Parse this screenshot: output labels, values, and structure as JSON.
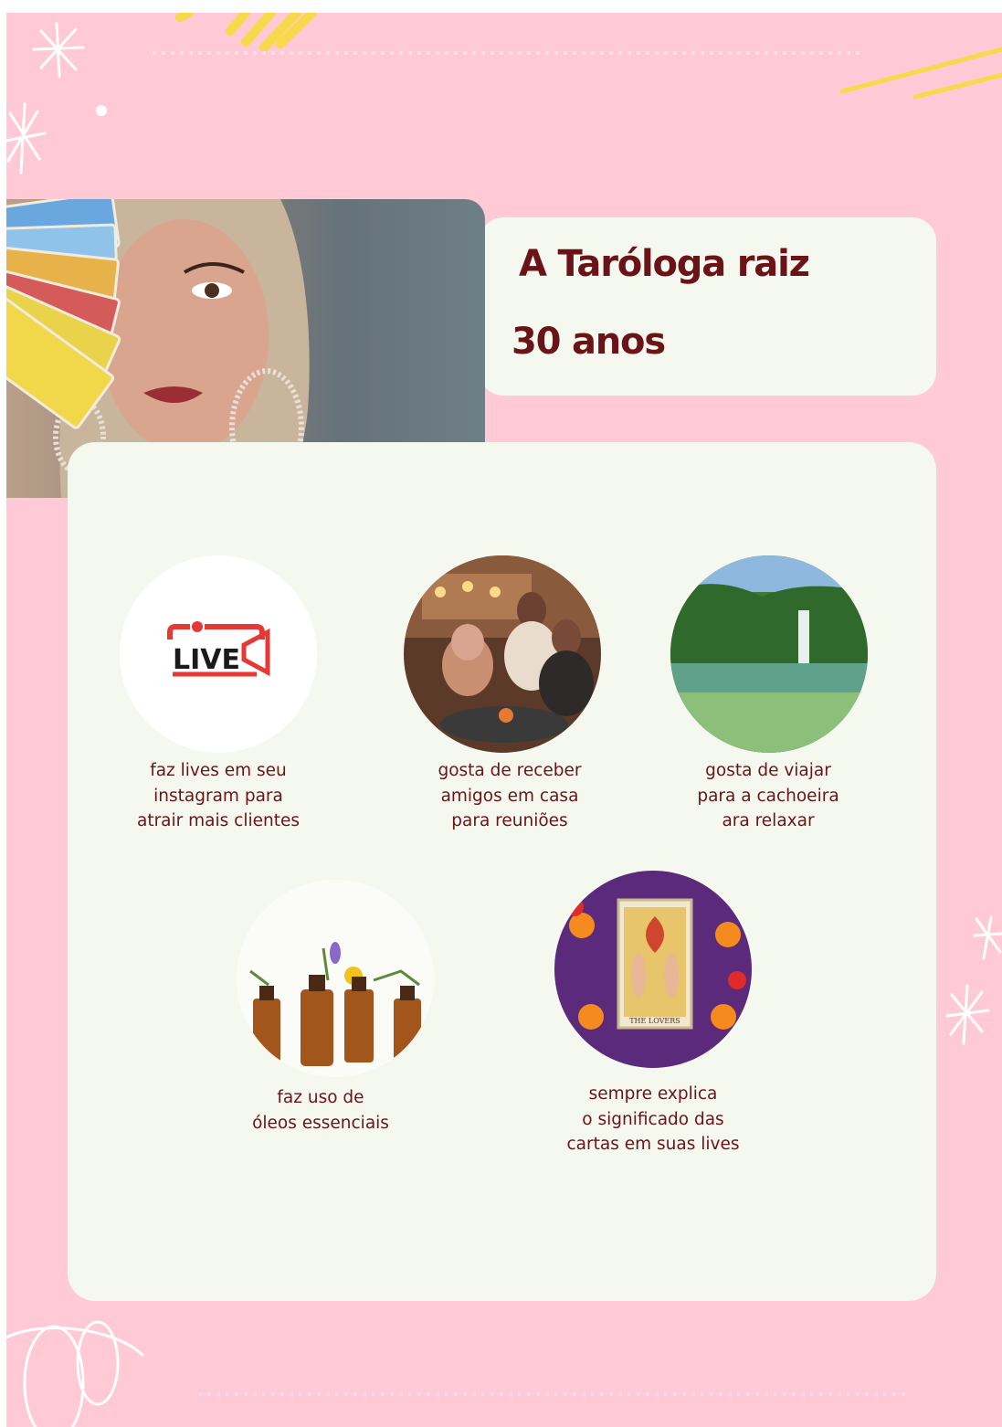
{
  "profile": {
    "title": "A Taróloga raiz",
    "age": "30 anos",
    "photo_alt": "Mulher segurando cartas de tarô em frente ao rosto"
  },
  "habits": [
    {
      "icon": "live-stream-icon",
      "live_label": "LIVE",
      "lines": [
        "faz lives em seu",
        "instagram para",
        "atrair mais clientes"
      ]
    },
    {
      "icon": "friends-gathering-photo",
      "lines": [
        "gosta de receber",
        "amigos em casa",
        "para reuniões"
      ]
    },
    {
      "icon": "waterfall-photo",
      "lines": [
        "gosta de viajar",
        "para a cachoeira",
        "ara relaxar"
      ]
    },
    {
      "icon": "essential-oils-photo",
      "lines": [
        "faz uso de",
        "óleos essenciais"
      ]
    },
    {
      "icon": "tarot-card-photo",
      "card_label": "THE LOVERS",
      "lines": [
        "sempre explica",
        "o significado das",
        "cartas em suas lives"
      ]
    }
  ],
  "colors": {
    "background": "#ffcad6",
    "card": "#f4f8ef",
    "text": "#6a1418",
    "live_red": "#e53935"
  }
}
